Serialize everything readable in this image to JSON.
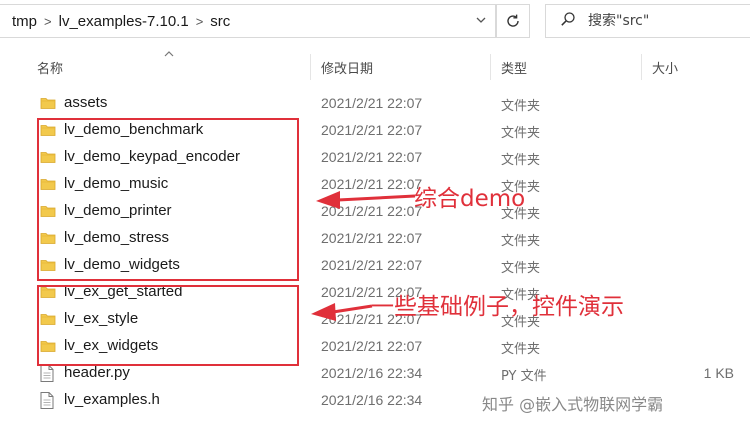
{
  "address_bar": {
    "breadcrumbs": [
      "tmp",
      "lv_examples-7.10.1",
      "src"
    ],
    "separator": ">"
  },
  "search": {
    "placeholder": "搜索\"src\""
  },
  "columns": {
    "name": "名称",
    "modified": "修改日期",
    "type": "类型",
    "size": "大小"
  },
  "files": [
    {
      "name": "assets",
      "modified": "2021/2/21 22:07",
      "type": "文件夹",
      "size": "",
      "kind": "folder"
    },
    {
      "name": "lv_demo_benchmark",
      "modified": "2021/2/21 22:07",
      "type": "文件夹",
      "size": "",
      "kind": "folder"
    },
    {
      "name": "lv_demo_keypad_encoder",
      "modified": "2021/2/21 22:07",
      "type": "文件夹",
      "size": "",
      "kind": "folder"
    },
    {
      "name": "lv_demo_music",
      "modified": "2021/2/21 22:07",
      "type": "文件夹",
      "size": "",
      "kind": "folder"
    },
    {
      "name": "lv_demo_printer",
      "modified": "2021/2/21 22:07",
      "type": "文件夹",
      "size": "",
      "kind": "folder"
    },
    {
      "name": "lv_demo_stress",
      "modified": "2021/2/21 22:07",
      "type": "文件夹",
      "size": "",
      "kind": "folder"
    },
    {
      "name": "lv_demo_widgets",
      "modified": "2021/2/21 22:07",
      "type": "文件夹",
      "size": "",
      "kind": "folder"
    },
    {
      "name": "lv_ex_get_started",
      "modified": "2021/2/21 22:07",
      "type": "文件夹",
      "size": "",
      "kind": "folder"
    },
    {
      "name": "lv_ex_style",
      "modified": "2021/2/21 22:07",
      "type": "文件夹",
      "size": "",
      "kind": "folder"
    },
    {
      "name": "lv_ex_widgets",
      "modified": "2021/2/21 22:07",
      "type": "文件夹",
      "size": "",
      "kind": "folder"
    },
    {
      "name": "header.py",
      "modified": "2021/2/16 22:34",
      "type": "PY 文件",
      "size": "1 KB",
      "kind": "file"
    },
    {
      "name": "lv_examples.h",
      "modified": "2021/2/16 22:34",
      "type": "",
      "size": "",
      "kind": "file"
    }
  ],
  "annotations": {
    "demo_label": "综合demo",
    "examples_label": "一些基础例子，控件演示",
    "color": "#e0303a"
  },
  "watermark": "知乎 @嵌入式物联网学霸",
  "icons": {
    "folder": "folder-icon",
    "file": "document-icon",
    "refresh": "refresh-icon",
    "search": "search-icon"
  },
  "colors": {
    "folder": "#f2c94c",
    "annotation": "#e0303a"
  }
}
